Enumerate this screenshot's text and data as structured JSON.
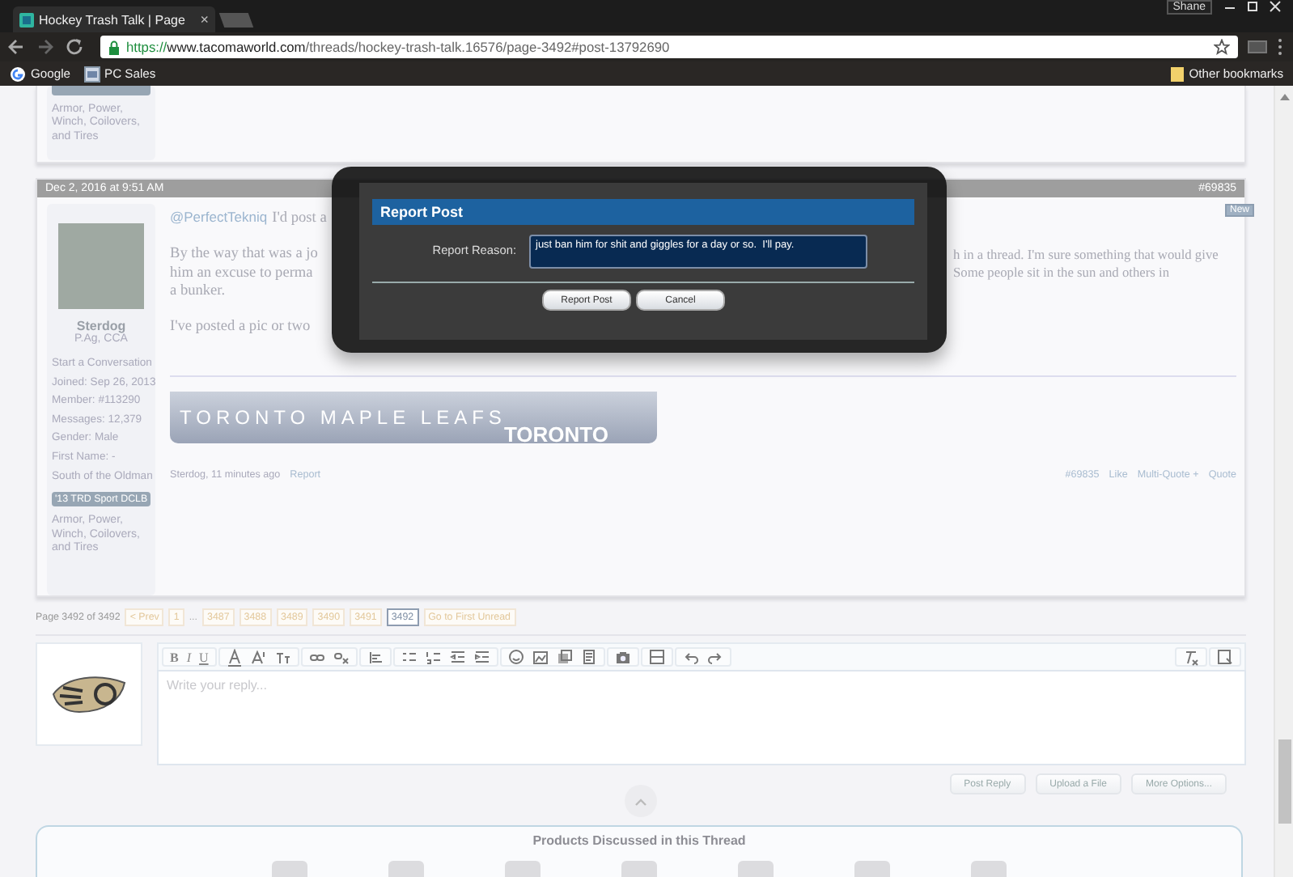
{
  "browser": {
    "tab_title": "Hockey Trash Talk | Page",
    "tab_close": "×",
    "profile": "Shane",
    "url": {
      "scheme": "https://",
      "host": "www.tacomaworld.com",
      "path": "/threads/hockey-trash-talk.16576/page-3492#post-13792690"
    },
    "bookmarks": [
      {
        "label": "Google",
        "kind": "google"
      },
      {
        "label": "PC Sales",
        "kind": "page"
      }
    ],
    "other_bookmarks": "Other bookmarks"
  },
  "previous_post": {
    "user_fields": "Armor, Power, Winch, Coilovers, and Tires"
  },
  "post": {
    "date": "Dec 2, 2016 at 9:51 AM",
    "number": "#69835",
    "new_badge": "New",
    "user": {
      "name": "Sterdog",
      "title": "P.Ag, CCA",
      "start_conversation": "Start a Conversation",
      "stats": [
        "Joined: Sep 26, 2013",
        "Member: #113290",
        "Messages: 12,379",
        "Gender: Male",
        "First Name: -",
        "South of the Oldman"
      ],
      "badge": "'13 TRD Sport DCLB",
      "fields": "Armor, Power, Winch, Coilovers, and Tires"
    },
    "mention": "@PerfectTekniq",
    "lines": [
      {
        "left": "I'd post a"
      },
      {
        "left": "By the way that was a jo",
        "right": "h in a thread. I'm sure something that would give"
      },
      {
        "left": "him an excuse to perma",
        "right": "Some people sit in the sun and others in"
      },
      {
        "left": "a bunker."
      },
      {
        "left": "I've posted a pic or two"
      }
    ],
    "signature": {
      "text": "TORONTO MAPLE LEAFS",
      "logo_text": "TORONTO"
    },
    "author_line": "Sterdog, 11 minutes ago",
    "report": "Report",
    "actions": [
      "#69835",
      "Like",
      "Multi-Quote +",
      "Quote"
    ]
  },
  "pagination": {
    "label": "Page 3492 of 3492",
    "prev": "< Prev",
    "items": [
      {
        "label": "1",
        "kind": "page",
        "selected": false
      },
      {
        "label": "...",
        "kind": "gap",
        "selected": false
      },
      {
        "label": "3487",
        "kind": "page",
        "selected": false
      },
      {
        "label": "3488",
        "kind": "page",
        "selected": false
      },
      {
        "label": "3489",
        "kind": "page",
        "selected": false
      },
      {
        "label": "3490",
        "kind": "page",
        "selected": false
      },
      {
        "label": "3491",
        "kind": "page",
        "selected": false
      },
      {
        "label": "3492",
        "kind": "page",
        "selected": true
      }
    ],
    "first_unread": "Go to First Unread"
  },
  "reply": {
    "format_buttons": [
      "B",
      "I",
      "U"
    ],
    "placeholder": "Write your reply...",
    "buttons": [
      "Post Reply",
      "Upload a File",
      "More Options..."
    ]
  },
  "products": {
    "title": "Products Discussed in this Thread"
  },
  "dialog": {
    "title": "Report Post",
    "label": "Report Reason:",
    "reason": "just ban him for shit and giggles for a day or so.  I'll pay.",
    "buttons": [
      "Report Post",
      "Cancel"
    ]
  }
}
